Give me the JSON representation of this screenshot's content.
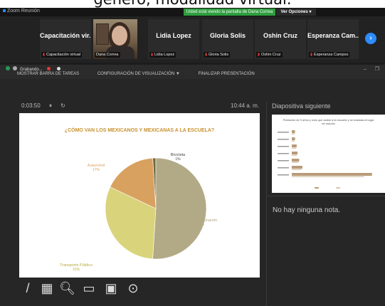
{
  "caption": "género, modalidad virtual.",
  "app_title": "Zoom Reunión",
  "share_banner": "Usted está viendo la pantalla de Dana Correa",
  "view_options": "Ver Opciones ▾",
  "participants": [
    {
      "name": "Capacitación vir...",
      "tag": "Capacitación virtual"
    },
    {
      "name": "",
      "tag": "Dana Correa"
    },
    {
      "name": "Lidia Lopez",
      "tag": "Lidia Lopez"
    },
    {
      "name": "Gloria Solis",
      "tag": "Gloria Solis"
    },
    {
      "name": "Oshin Cruz",
      "tag": "Oshin Cruz"
    },
    {
      "name": "Esperanza Cam...",
      "tag": "Esperanza Campos"
    }
  ],
  "recording": "Grabando...",
  "toolbar": {
    "show_taskbar": "MOSTRAR BARRA DE TAREAS",
    "display_settings": "CONFIGURACIÓN DE VISUALIZACIÓN ▼",
    "end_presentation": "FINALIZAR PRESENTACIÓN"
  },
  "timer": "0:03:50",
  "clock": "10:44 a. m.",
  "next_slide_title": "Diapositiva siguiente",
  "no_notes": "No hay ninguna nota.",
  "thumb_title": "Población de 3 años y más que asiste a la escuela y se traslada al lugar de estudio",
  "chart_data": {
    "type": "pie",
    "title": "¿CÓMO VAN LOS MEXICANOS Y MEXICANAS A LA ESCUELA?",
    "slices": [
      {
        "label": "Caminando",
        "value": 51,
        "display": "51%",
        "color": "#b2aa86"
      },
      {
        "label": "Transporte Público",
        "value": 31,
        "display": "31%",
        "color": "#d9d47c"
      },
      {
        "label": "Automóvil",
        "value": 17,
        "display": "17%",
        "color": "#d9a15f"
      },
      {
        "label": "Bicicleta",
        "value": 1,
        "display": "1%",
        "color": "#6d6d46"
      }
    ]
  },
  "thumb_chart": {
    "type": "bar",
    "values": [
      4,
      4,
      6,
      7,
      9,
      13,
      98
    ]
  },
  "colors": {
    "share_green": "#2e9e3e",
    "zoom_blue": "#2d8cff",
    "title_gold": "#c8912e"
  },
  "icons": [
    "pen-icon",
    "slides-grid-icon",
    "magnifier-icon",
    "screen-share-icon",
    "black-screen-icon",
    "more-icon"
  ]
}
